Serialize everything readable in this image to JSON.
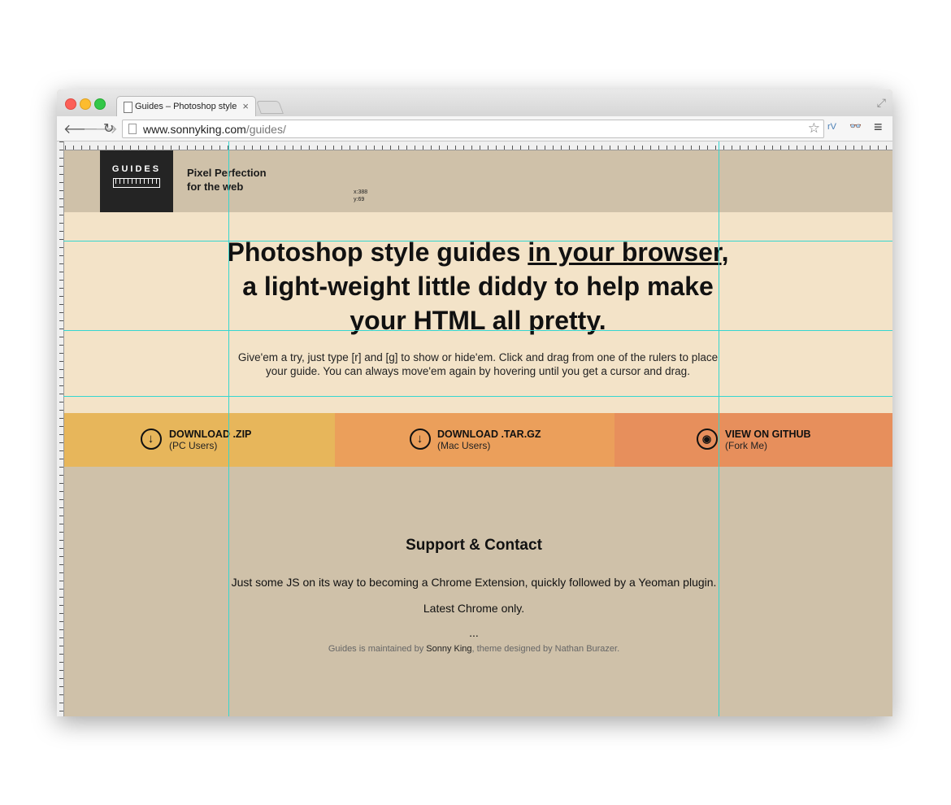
{
  "browser": {
    "tab_title": "Guides – Photoshop style g",
    "tab_close": "×",
    "url_host": "www.sonnyking.com",
    "url_path": "/guides/",
    "back_glyph": "🡐",
    "forward_glyph": "🡒",
    "reload_glyph": "↻",
    "star_glyph": "☆",
    "menu_glyph": "≡",
    "fullscreen_glyph": "⤢",
    "ext1": "rV",
    "ext2": "👓"
  },
  "header": {
    "badge_text": "GUIDES",
    "tagline_line1": "Pixel Perfection",
    "tagline_line2": "for the web",
    "coord_x": "x:388",
    "coord_y": "y:69"
  },
  "hero": {
    "heading_part1": "Photoshop style guides ",
    "heading_link1": "in your browser",
    "heading_part2": ", a light-weight little diddy to help make your HTML all pretty.",
    "description": "Give'em a try, just type [r] and [g] to show or hide'em. Click and drag from one of the rulers to place your guide. You can always move'em again by hovering until you get a cursor and drag."
  },
  "downloads": [
    {
      "label": "DOWNLOAD .ZIP",
      "sub": "(PC Users)",
      "icon": "↓"
    },
    {
      "label": "DOWNLOAD .TAR.GZ",
      "sub": "(Mac Users)",
      "icon": "↓"
    },
    {
      "label": "VIEW ON GITHUB",
      "sub": "(Fork Me)",
      "icon": "◉"
    }
  ],
  "footer": {
    "title": "Support & Contact",
    "line1": "Just some JS on its way to becoming a Chrome Extension, quickly followed by a Yeoman plugin.",
    "line2": "Latest Chrome only.",
    "line3": "...",
    "credit_prefix": "Guides is maintained by ",
    "credit_name": "Sonny King",
    "credit_suffix": ", theme designed by Nathan Burazer."
  },
  "colors": {
    "header_bg": "#cfc1a9",
    "hero_bg": "#f3e3c8",
    "zip_bg": "#e7b65b",
    "tar_bg": "#eb9f5b",
    "github_bg": "#e78f5c",
    "guide_line": "#35d6d0"
  }
}
